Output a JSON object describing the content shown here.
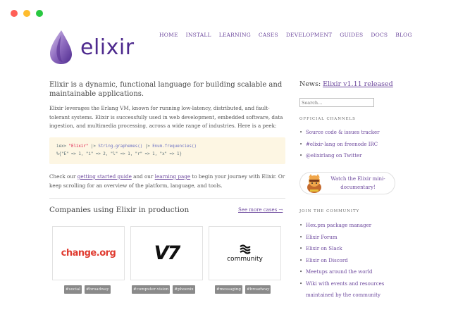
{
  "colors": {
    "accent": "#6e4a9e",
    "logo": "#4e2a8e",
    "code_bg": "#fdf6e3",
    "tag_bg": "#8a8a8a"
  },
  "window": {
    "controls": [
      "close",
      "minimize",
      "maximize"
    ]
  },
  "brand": {
    "name": "elixir"
  },
  "nav": [
    "HOME",
    "INSTALL",
    "LEARNING",
    "CASES",
    "DEVELOPMENT",
    "GUIDES",
    "DOCS",
    "BLOG"
  ],
  "intro": "Elixir is a dynamic, functional language for building scalable and maintainable applications.",
  "description": "Elixir leverages the Erlang VM, known for running low-latency, distributed, and fault-tolerant systems. Elixir is successfully used in web development, embedded software, data ingestion, and multimedia processing, across a wide range of industries. Here is a peek:",
  "code": {
    "prompt": "iex>",
    "string": "\"Elixir\"",
    "pipe1": "|>",
    "call1": "String.graphemes()",
    "pipe2": "|>",
    "call2": "Enum.frequencies()",
    "result": "%{\"E\" => 1, \"i\" => 2, \"l\" => 1, \"r\" => 1, \"x\" => 1}"
  },
  "check": {
    "before": "Check our ",
    "link1": "getting started guide",
    "middle": " and our ",
    "link2": "learning page",
    "after": " to begin your journey with Elixir. Or keep scrolling for an overview of the platform, language, and tools."
  },
  "companies": {
    "title": "Companies using Elixir in production",
    "see_more": "See more cases →",
    "items": [
      {
        "logo_text": "change.org",
        "tags": [
          "#social",
          "#broadway"
        ]
      },
      {
        "logo_text": "V7",
        "tags": [
          "#computer-vision",
          "#phoenix"
        ]
      },
      {
        "logo_text": "community",
        "tags": [
          "#messaging",
          "#broadway"
        ]
      }
    ]
  },
  "sidebar": {
    "news_label": "News: ",
    "news_link": "Elixir v1.11 released",
    "search_placeholder": "Search...",
    "channels_heading": "OFFICIAL CHANNELS",
    "channels": [
      "Source code & issues tracker",
      "#elixir-lang on freenode IRC",
      "@elixirlang on Twitter"
    ],
    "documentary": "Watch the Elixir mini-documentary!",
    "community_heading": "JOIN THE COMMUNITY",
    "community": [
      "Hex.pm package manager",
      "Elixir Forum",
      "Elixir on Slack",
      "Elixir on Discord",
      "Meetups around the world",
      "Wiki with events and resources maintained by the community"
    ]
  }
}
